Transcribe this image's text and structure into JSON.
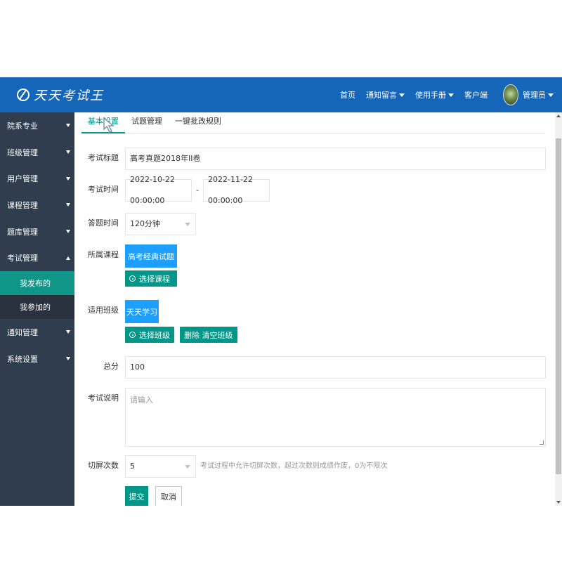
{
  "header": {
    "logo_text": "天天考试王",
    "nav": [
      {
        "label": "首页",
        "has_caret": false
      },
      {
        "label": "通知留言",
        "has_caret": true
      },
      {
        "label": "使用手册",
        "has_caret": true
      },
      {
        "label": "客户端",
        "has_caret": false
      }
    ],
    "user_label": "管理员"
  },
  "sidebar": {
    "items": [
      {
        "label": "院系专业"
      },
      {
        "label": "班级管理"
      },
      {
        "label": "用户管理"
      },
      {
        "label": "课程管理"
      },
      {
        "label": "题库管理"
      },
      {
        "label": "考试管理",
        "expanded": true
      },
      {
        "label": "通知管理"
      },
      {
        "label": "系统设置"
      }
    ],
    "exam_sub": [
      {
        "label": "我发布的",
        "active": true
      },
      {
        "label": "我参加的",
        "active": false
      }
    ]
  },
  "tabs": [
    {
      "label": "基本设置",
      "active": true
    },
    {
      "label": "试题管理",
      "active": false
    },
    {
      "label": "一键批改规则",
      "active": false
    }
  ],
  "form": {
    "title_label": "考试标题",
    "title_value": "高考真题2018年II卷",
    "time_label": "考试时间",
    "time_start": "2022-10-22 00:00:00",
    "time_sep": "-",
    "time_end": "2022-11-22 00:00:00",
    "duration_label": "答题时间",
    "duration_value": "120分钟",
    "course_label": "所属课程",
    "course_tag": "高考经典试题",
    "choose_course_btn": "选择课程",
    "class_label": "适用班级",
    "class_tag": "天天学习",
    "choose_class_btn": "选择班级",
    "clear_class_btn": "删除 清空班级",
    "score_label": "总分",
    "score_value": "100",
    "desc_label": "考试说明",
    "desc_placeholder": "请输入",
    "switch_label": "切屏次数",
    "switch_value": "5",
    "switch_hint": "考试过程中允许切屏次数，超过次数则成绩作废，0为不限次",
    "submit_btn": "提交",
    "cancel_btn": "取消"
  },
  "colors": {
    "header_bg": "#1565b8",
    "sidebar_bg": "#2f3d4e",
    "accent_teal": "#009688",
    "accent_blue": "#1e9fff"
  }
}
